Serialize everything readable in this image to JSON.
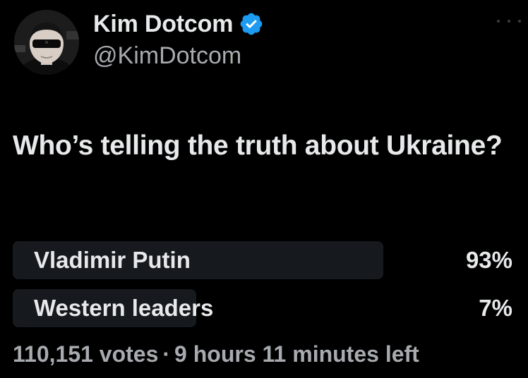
{
  "author": {
    "display_name": "Kim Dotcom",
    "handle": "@KimDotcom",
    "verified": true,
    "verified_icon": "verified-badge-icon",
    "avatar_icon": "avatar-photo"
  },
  "tweet": {
    "text": "Who’s telling the truth about Ukraine?"
  },
  "poll": {
    "options": [
      {
        "label": "Vladimir Putin",
        "percent_text": "93%",
        "percent": 93
      },
      {
        "label": "Western leaders",
        "percent_text": "7%",
        "percent": 7
      }
    ],
    "votes": "110,151 votes",
    "separator": "·",
    "time_left": "9 hours 11 minutes left"
  },
  "colors": {
    "background": "#000000",
    "text": "#e7e9ea",
    "secondary_text": "#a7aaae",
    "verified_blue": "#1d9bf0",
    "poll_bar": "#161a1e"
  }
}
